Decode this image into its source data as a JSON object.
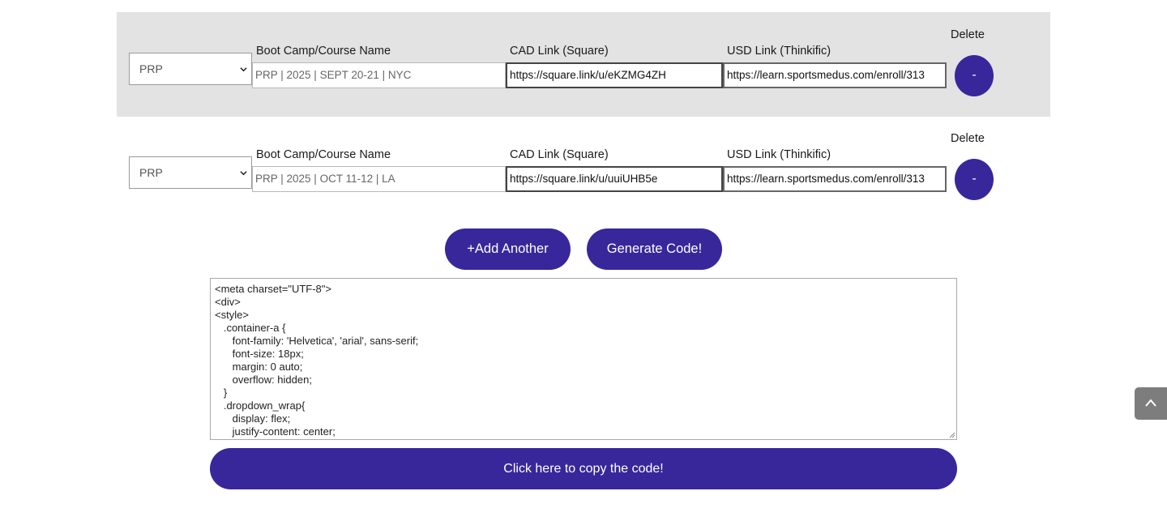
{
  "rows": [
    {
      "course_type": "PRP",
      "name_label": "Boot Camp/Course Name",
      "name_value": "PRP | 2025 | SEPT 20-21 | NYC",
      "cad_label": "CAD Link (Square)",
      "cad_value": "https://square.link/u/eKZMG4ZH",
      "usd_label": "USD Link (Thinkific)",
      "usd_value": "https://learn.sportsmedus.com/enroll/313",
      "delete_label": "Delete",
      "delete_button": "-"
    },
    {
      "course_type": "PRP",
      "name_label": "Boot Camp/Course Name",
      "name_value": "PRP | 2025 | OCT 11-12 | LA",
      "cad_label": "CAD Link (Square)",
      "cad_value": "https://square.link/u/uuiUHB5e",
      "usd_label": "USD Link (Thinkific)",
      "usd_value": "https://learn.sportsmedus.com/enroll/313",
      "delete_label": "Delete",
      "delete_button": "-"
    }
  ],
  "actions": {
    "add_another": "+Add Another",
    "generate_code": "Generate Code!"
  },
  "code_output": {
    "lines": [
      "<meta charset=\"UTF-8\">",
      "<div>",
      "<style>",
      "   .container-a {",
      "      font-family: 'Helvetica', 'arial', sans-serif;",
      "      font-size: 18px;",
      "      margin: 0 auto;",
      "      overflow: hidden;",
      "   }",
      "   .dropdown_wrap{",
      "      display: flex;",
      "      justify-content: center;"
    ]
  },
  "copy_button": "Click here to copy the code!",
  "scroll_top_icon": "chevron-up-icon",
  "colors": {
    "accent": "#37279b",
    "row_shade": "#e3e3e3",
    "scroll_top_bg": "#7d7d7d"
  }
}
